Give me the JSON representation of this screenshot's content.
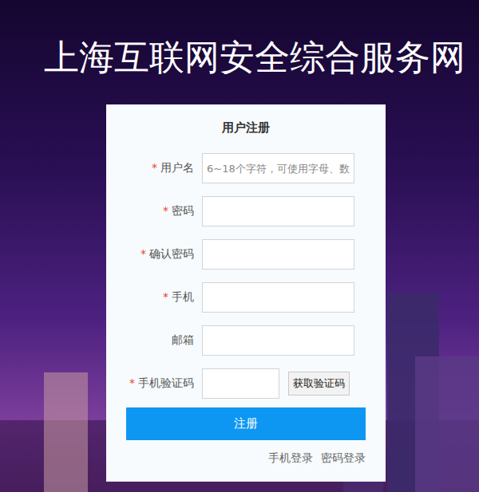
{
  "site_title": "上海互联网安全综合服务网",
  "form": {
    "heading": "用户注册",
    "required_mark": "*",
    "fields": [
      {
        "label": "用户名",
        "required": true,
        "kind": "text",
        "placeholder": "6~18个字符，可使用字母、数"
      },
      {
        "label": "密码",
        "required": true,
        "kind": "password",
        "placeholder": ""
      },
      {
        "label": "确认密码",
        "required": true,
        "kind": "password",
        "placeholder": ""
      },
      {
        "label": "手机",
        "required": true,
        "kind": "text",
        "placeholder": ""
      },
      {
        "label": "邮箱",
        "required": false,
        "kind": "text",
        "placeholder": ""
      },
      {
        "label": "手机验证码",
        "required": true,
        "kind": "code",
        "placeholder": "",
        "button": "获取验证码"
      }
    ],
    "submit": "注册",
    "links": [
      "手机登录",
      "密码登录"
    ]
  }
}
